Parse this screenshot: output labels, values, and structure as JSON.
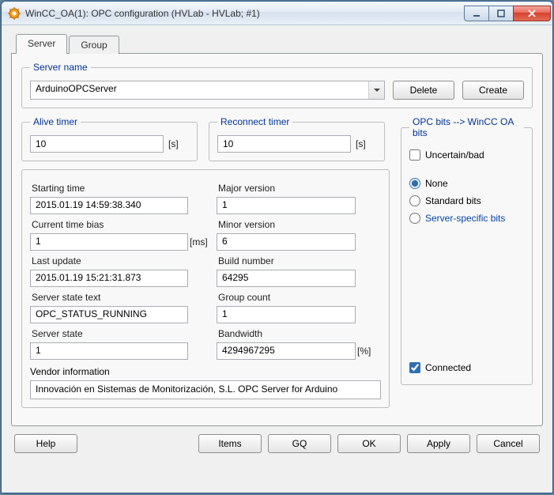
{
  "window": {
    "title": "WinCC_OA(1): OPC configuration (HVLab - HVLab; #1)"
  },
  "tabs": {
    "server": "Server",
    "group": "Group"
  },
  "server_name": {
    "legend": "Server name",
    "value": "ArduinoOPCServer",
    "delete": "Delete",
    "create": "Create"
  },
  "alive_timer": {
    "legend": "Alive timer",
    "value": "10",
    "unit": "[s]"
  },
  "reconnect_timer": {
    "legend": "Reconnect timer",
    "value": "10",
    "unit": "[s]"
  },
  "info": {
    "starting_time_lbl": "Starting time",
    "starting_time": "2015.01.19 14:59:38.340",
    "current_time_bias_lbl": "Current time bias",
    "current_time_bias": "1",
    "current_time_bias_unit": "[ms]",
    "last_update_lbl": "Last update",
    "last_update": "2015.01.19 15:21:31.873",
    "server_state_text_lbl": "Server state text",
    "server_state_text": "OPC_STATUS_RUNNING",
    "server_state_lbl": "Server state",
    "server_state": "1",
    "major_version_lbl": "Major version",
    "major_version": "1",
    "minor_version_lbl": "Minor version",
    "minor_version": "6",
    "build_number_lbl": "Build number",
    "build_number": "64295",
    "group_count_lbl": "Group count",
    "group_count": "1",
    "bandwidth_lbl": "Bandwidth",
    "bandwidth": "4294967295",
    "bandwidth_unit": "[%]",
    "vendor_info_lbl": "Vendor information",
    "vendor_info": "Innovación en Sistemas de Monitorización, S.L. OPC Server for Arduino"
  },
  "bits": {
    "legend": "OPC bits --> WinCC OA bits",
    "uncertain": "Uncertain/bad",
    "none": "None",
    "standard": "Standard bits",
    "server_specific": "Server-specific bits",
    "connected": "Connected"
  },
  "buttons": {
    "help": "Help",
    "items": "Items",
    "gq": "GQ",
    "ok": "OK",
    "apply": "Apply",
    "cancel": "Cancel"
  }
}
